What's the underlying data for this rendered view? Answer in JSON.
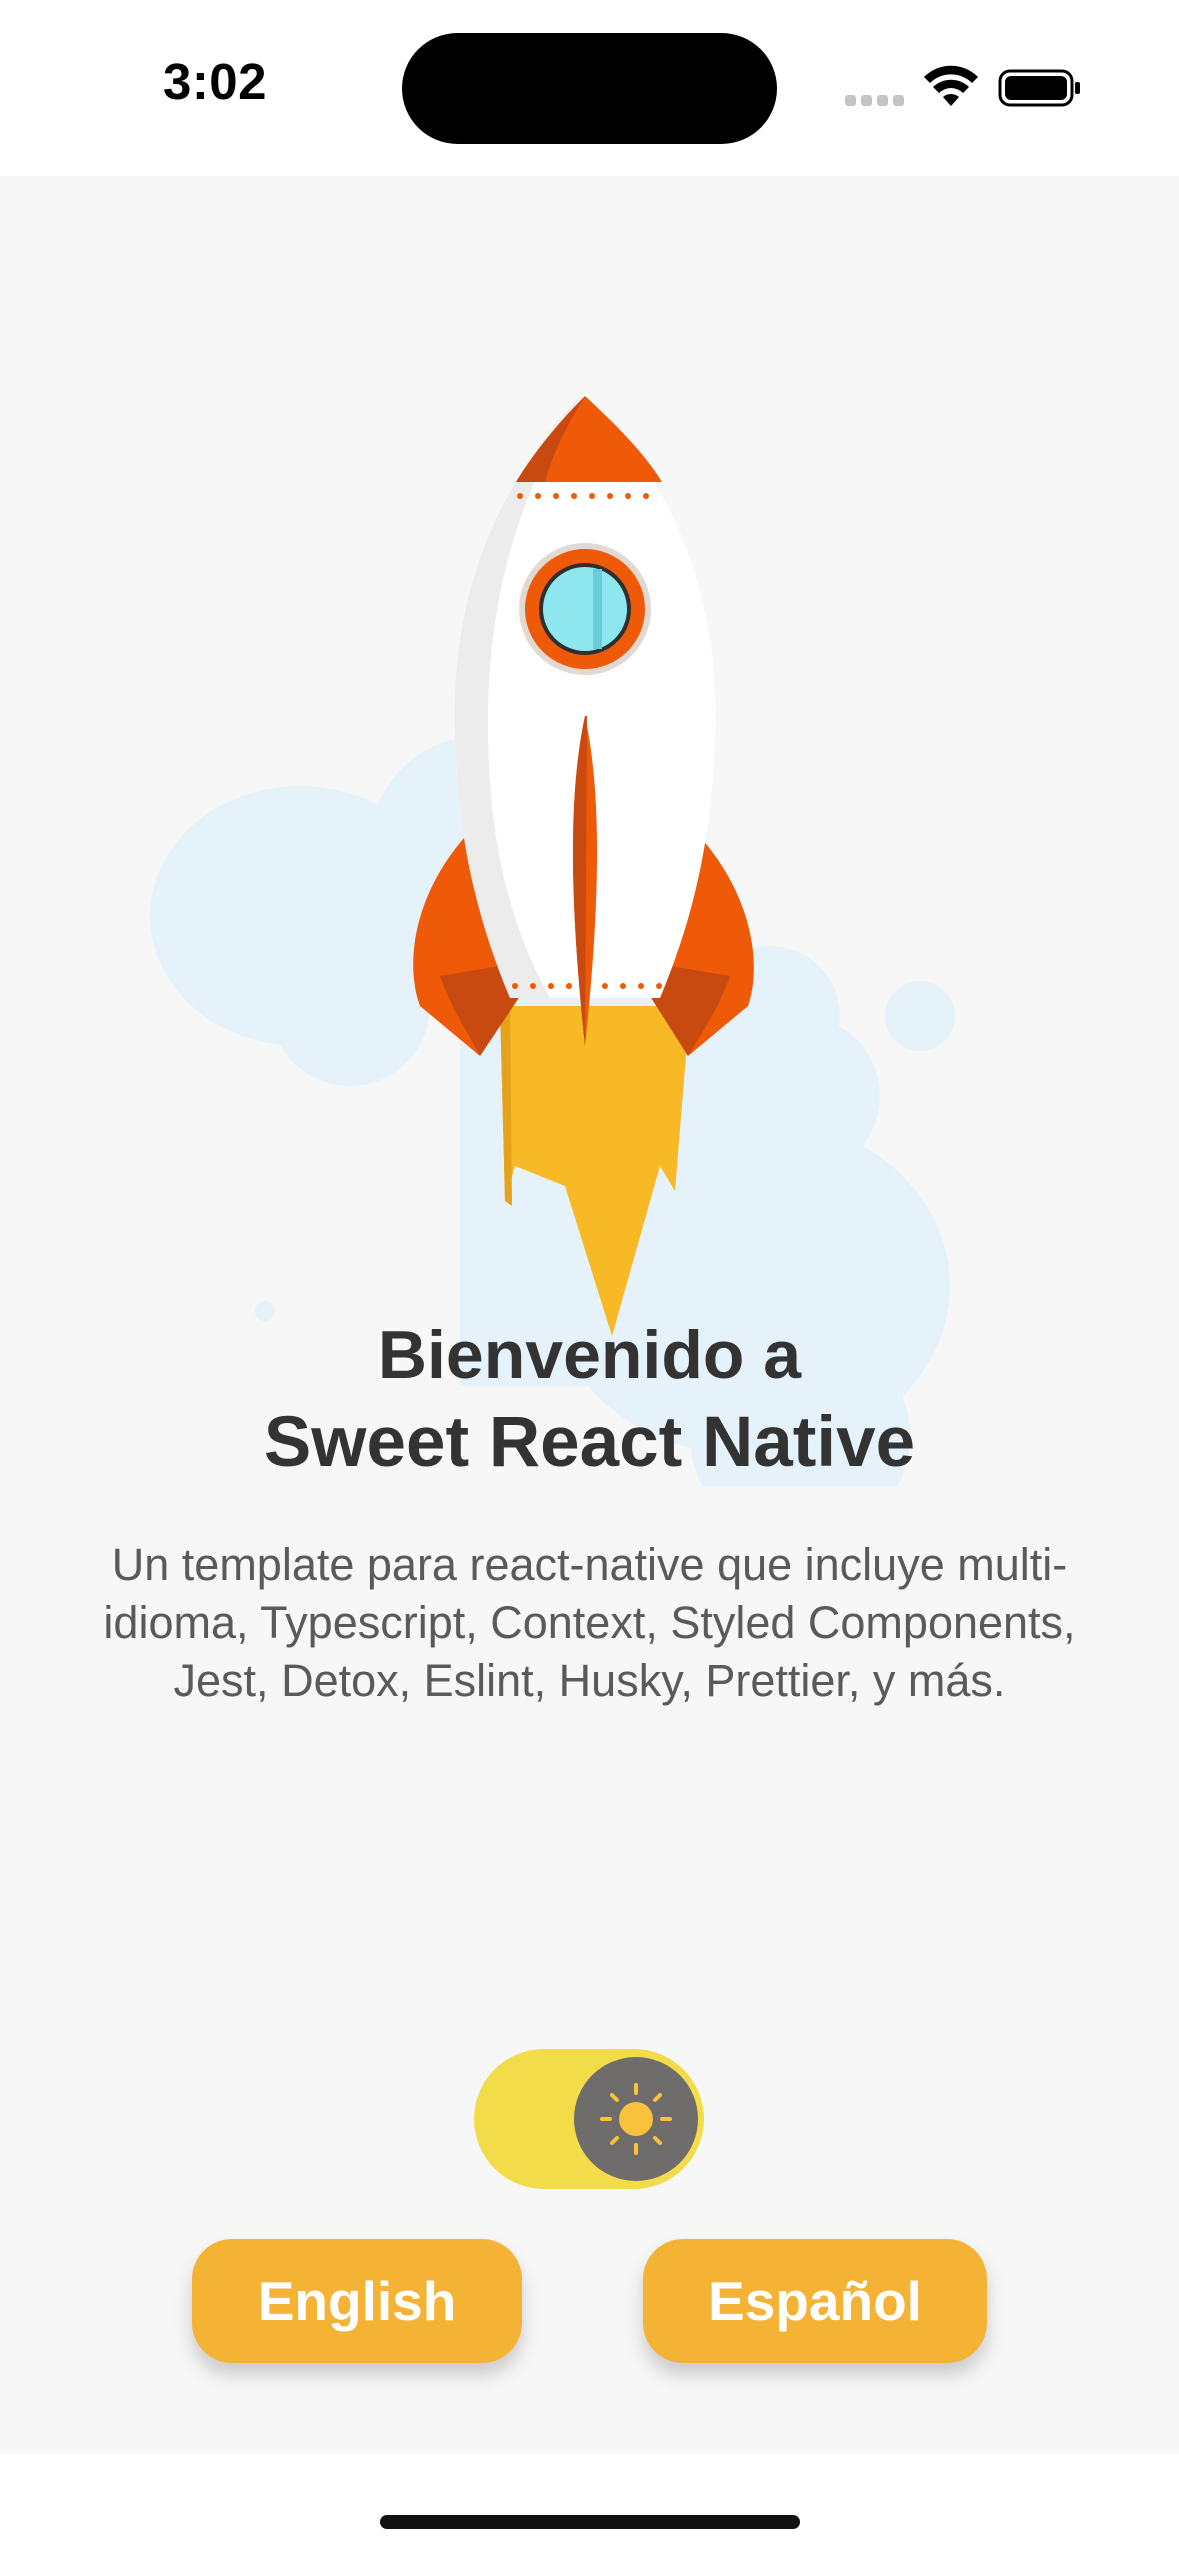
{
  "status_bar": {
    "time": "3:02",
    "icons": [
      "signal-icon",
      "wifi-icon",
      "battery-icon"
    ]
  },
  "main": {
    "illustration": "rocket-illustration",
    "title_line1": "Bienvenido a",
    "title_line2": "Sweet React Native",
    "description": "Un template para react-native que incluye multi-idioma, Typescript, Context, Styled Components, Jest, Detox, Eslint, Husky, Prettier, y más."
  },
  "theme_toggle": {
    "icon": "sun-icon",
    "mode": "light"
  },
  "language_buttons": {
    "english": "English",
    "spanish": "Español"
  },
  "colors": {
    "background": "#f7f7f7",
    "text_primary": "#333333",
    "text_secondary": "#5a5a5a",
    "button": "#f5b335",
    "toggle_track": "#f2dc4a",
    "toggle_thumb": "#6f6c6c",
    "rocket_orange": "#ee5a07",
    "flame_yellow": "#f7b926",
    "cloud": "#e6f2fa"
  }
}
